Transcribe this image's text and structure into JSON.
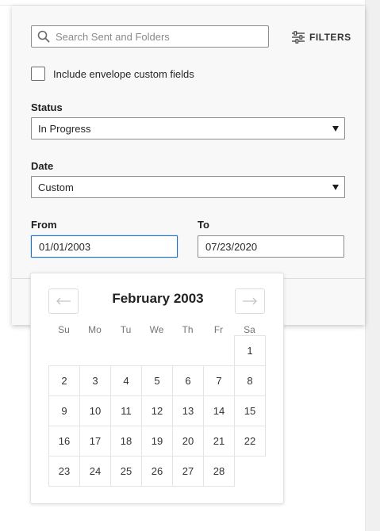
{
  "search": {
    "placeholder": "Search Sent and Folders"
  },
  "filters_button": {
    "label": "FILTERS"
  },
  "include_custom_fields": {
    "label": "Include envelope custom fields",
    "checked": false
  },
  "status": {
    "label": "Status",
    "value": "In Progress"
  },
  "date": {
    "label": "Date",
    "value": "Custom"
  },
  "from": {
    "label": "From",
    "value": "01/01/2003"
  },
  "to": {
    "label": "To",
    "value": "07/23/2020"
  },
  "calendar": {
    "month_label": "February 2003",
    "weekdays": [
      "Su",
      "Mo",
      "Tu",
      "We",
      "Th",
      "Fr",
      "Sa"
    ],
    "days": [
      "1",
      "2",
      "3",
      "4",
      "5",
      "6",
      "7",
      "8",
      "9",
      "10",
      "11",
      "12",
      "13",
      "14",
      "15",
      "16",
      "17",
      "18",
      "19",
      "20",
      "21",
      "22",
      "23",
      "24",
      "25",
      "26",
      "27",
      "28"
    ]
  },
  "colors": {
    "focus_border": "#1d6fcb",
    "panel_bg": "#f8f8f8"
  }
}
